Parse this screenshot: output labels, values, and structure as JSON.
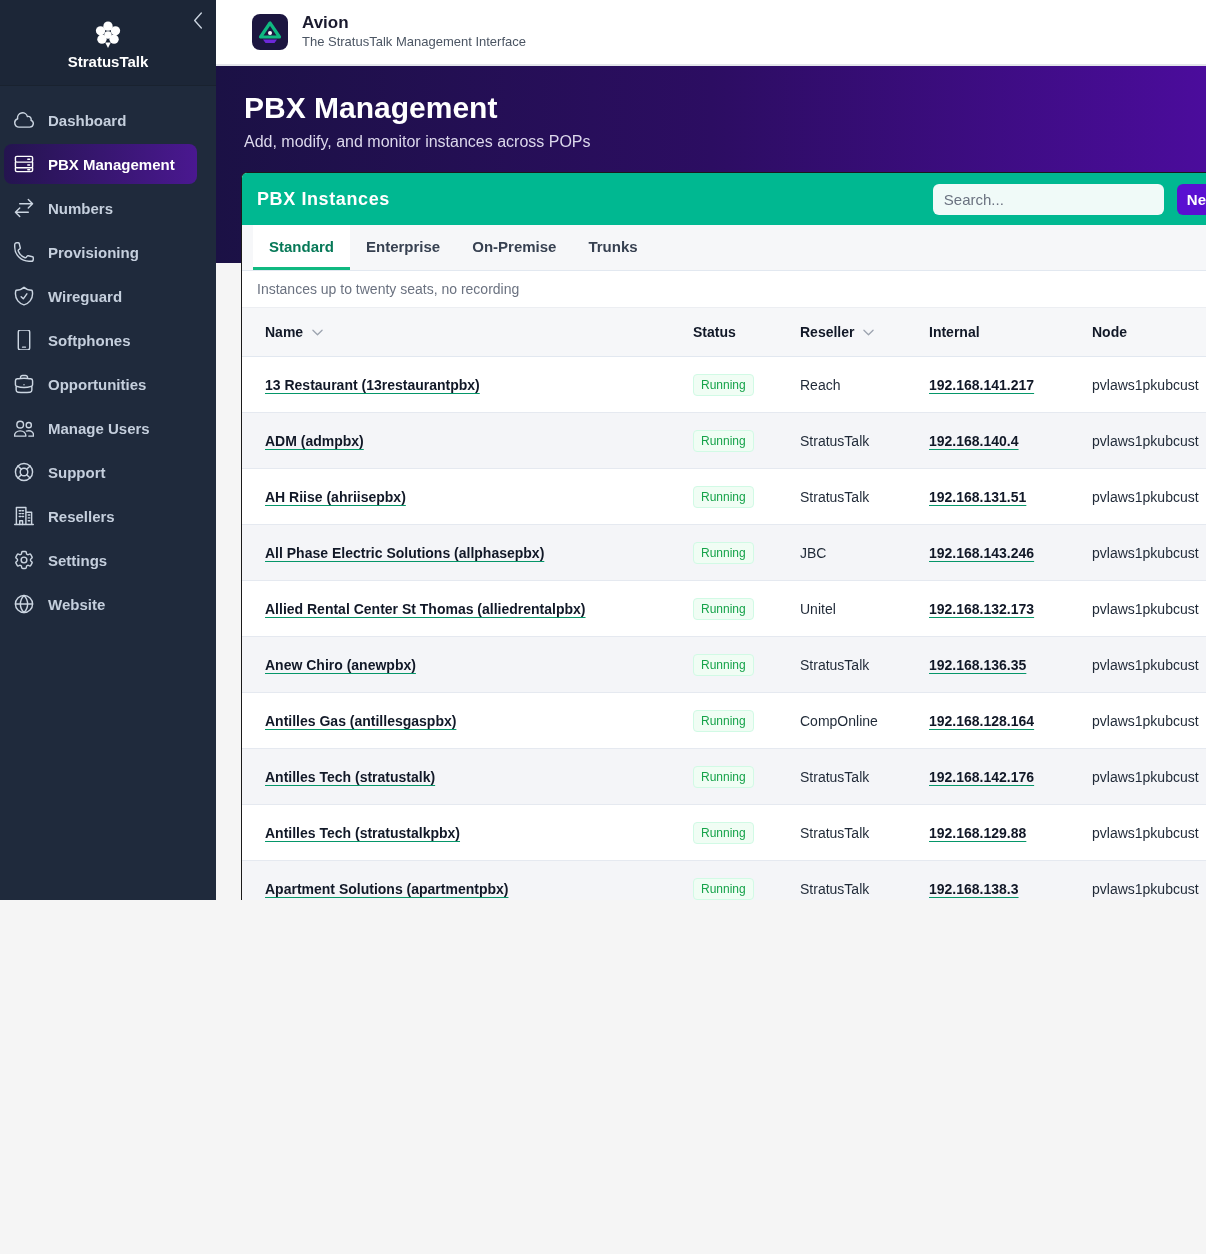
{
  "sidebar": {
    "brand": "StratusTalk",
    "items": [
      {
        "label": "Dashboard",
        "selected": false
      },
      {
        "label": "PBX Management",
        "selected": true
      },
      {
        "label": "Numbers",
        "selected": false
      },
      {
        "label": "Provisioning",
        "selected": false
      },
      {
        "label": "Wireguard",
        "selected": false
      },
      {
        "label": "Softphones",
        "selected": false
      },
      {
        "label": "Opportunities",
        "selected": false
      },
      {
        "label": "Manage Users",
        "selected": false
      },
      {
        "label": "Support",
        "selected": false
      },
      {
        "label": "Resellers",
        "selected": false
      },
      {
        "label": "Settings",
        "selected": false
      },
      {
        "label": "Website",
        "selected": false
      }
    ]
  },
  "header": {
    "app_name": "Avion",
    "tagline": "The StratusTalk Management Interface"
  },
  "hero": {
    "title": "PBX Management",
    "subtitle": "Add, modify, and monitor instances across POPs"
  },
  "card": {
    "title": "PBX Instances",
    "search": {
      "placeholder": "Search..."
    },
    "button": "Ne",
    "tabs": [
      {
        "label": "Standard",
        "selected": true
      },
      {
        "label": "Enterprise",
        "selected": false
      },
      {
        "label": "On-Premise",
        "selected": false
      },
      {
        "label": "Trunks",
        "selected": false
      }
    ],
    "description": "Instances up to twenty seats, no recording",
    "table": {
      "columns": [
        {
          "label": "Name",
          "sort_menu": true
        },
        {
          "label": "Status",
          "sort_menu": false
        },
        {
          "label": "Reseller",
          "sort_menu": true
        },
        {
          "label": "Internal",
          "sort_menu": false
        },
        {
          "label": "Node",
          "sort_menu": false
        }
      ],
      "rows": [
        {
          "name": "13 Restaurant (13restaurantpbx)",
          "status": "Running",
          "reseller": "Reach",
          "internal": "192.168.141.217",
          "node": "pvlaws1pkubcust"
        },
        {
          "name": "ADM (admpbx)",
          "status": "Running",
          "reseller": "StratusTalk",
          "internal": "192.168.140.4",
          "node": "pvlaws1pkubcust"
        },
        {
          "name": "AH Riise (ahriisepbx)",
          "status": "Running",
          "reseller": "StratusTalk",
          "internal": "192.168.131.51",
          "node": "pvlaws1pkubcust"
        },
        {
          "name": "All Phase Electric Solutions (allphasepbx)",
          "status": "Running",
          "reseller": "JBC",
          "internal": "192.168.143.246",
          "node": "pvlaws1pkubcust"
        },
        {
          "name": "Allied Rental Center St Thomas (alliedrentalpbx)",
          "status": "Running",
          "reseller": "Unitel",
          "internal": "192.168.132.173",
          "node": "pvlaws1pkubcust"
        },
        {
          "name": "Anew Chiro (anewpbx)",
          "status": "Running",
          "reseller": "StratusTalk",
          "internal": "192.168.136.35",
          "node": "pvlaws1pkubcust"
        },
        {
          "name": "Antilles Gas (antillesgaspbx)",
          "status": "Running",
          "reseller": "CompOnline",
          "internal": "192.168.128.164",
          "node": "pvlaws1pkubcust"
        },
        {
          "name": "Antilles Tech (stratustalk)",
          "status": "Running",
          "reseller": "StratusTalk",
          "internal": "192.168.142.176",
          "node": "pvlaws1pkubcust"
        },
        {
          "name": "Antilles Tech (stratustalkpbx)",
          "status": "Running",
          "reseller": "StratusTalk",
          "internal": "192.168.129.88",
          "node": "pvlaws1pkubcust"
        },
        {
          "name": "Apartment Solutions (apartmentpbx)",
          "status": "Running",
          "reseller": "StratusTalk",
          "internal": "192.168.138.3",
          "node": "pvlaws1pkubcust"
        }
      ]
    }
  }
}
